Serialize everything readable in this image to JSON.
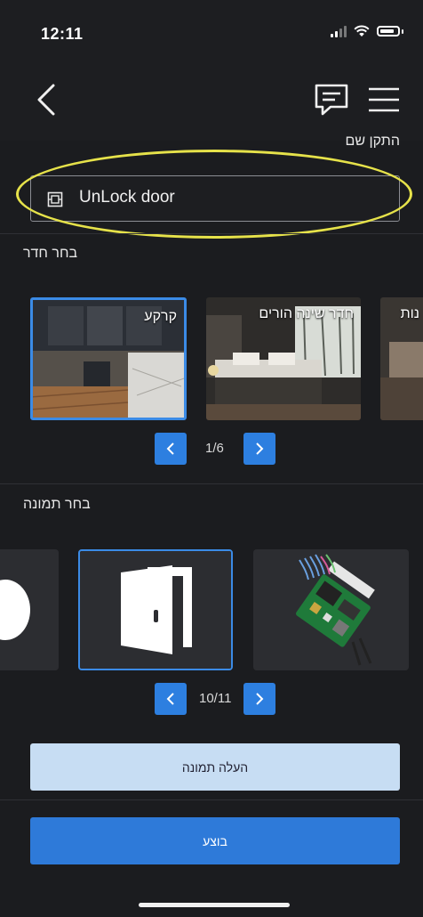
{
  "status_bar": {
    "time": "12:11"
  },
  "section_device": {
    "label": "התקן שם",
    "device_name": "UnLock door"
  },
  "section_room": {
    "label": "בחר חדר",
    "rooms": [
      {
        "name": "קרקע"
      },
      {
        "name": "חדר שינה הורים"
      },
      {
        "name": "נות"
      }
    ],
    "page": "1/6"
  },
  "section_image": {
    "label": "בחר תמונה",
    "page": "10/11"
  },
  "buttons": {
    "upload": "העלה תמונה",
    "execute": "בוצע"
  },
  "colors": {
    "accent": "#2e7ad9",
    "highlight": "#e6e24a",
    "background": "#1b1c1f"
  }
}
